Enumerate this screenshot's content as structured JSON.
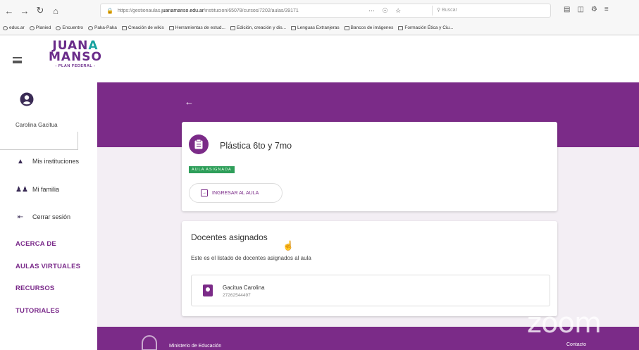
{
  "browser": {
    "url_prefix": "https://gestionaulas.",
    "url_domain": "juanamanso.edu.ar",
    "url_path": "/institucion/65078/cursos/7202/aulas/39171",
    "search_placeholder": "Buscar",
    "bookmarks": [
      "educ.ar",
      "Planied",
      "Encuentro",
      "Paka-Paka",
      "Creación de wikis",
      "Herramientas de estud...",
      "Edición, creación y dis...",
      "Lenguas Extranjeras",
      "Bancos de imágenes",
      "Formación Ética y Ciu..."
    ]
  },
  "logo": {
    "line1_a": "JUAN",
    "line1_b": "A",
    "line2": "MANSO",
    "line3": "- PLAN FEDERAL -"
  },
  "sidebar": {
    "user_name": "Carolina Gacitua",
    "items": [
      {
        "label": "Mis instituciones",
        "icon": "graduation-cap-icon"
      },
      {
        "label": "Mi familia",
        "icon": "family-icon"
      },
      {
        "label": "Cerrar sesión",
        "icon": "logout-icon"
      }
    ],
    "links": [
      "ACERCA DE",
      "AULAS VIRTUALES",
      "RECURSOS",
      "TUTORIALES"
    ]
  },
  "classroom": {
    "title": "Plástica 6to y 7mo",
    "badge": "AULA ASIGNADA",
    "enter_label": "INGRESAR AL AULA"
  },
  "teachers": {
    "title": "Docentes asignados",
    "description": "Este es el listado de docentes asignados al aula",
    "list": [
      {
        "name": "Gacitua Carolina",
        "id": "27262544497"
      }
    ]
  },
  "footer": {
    "ministry": "Ministerio de Educación",
    "contact": "Contacto"
  },
  "overlay": {
    "zoom": "zoom"
  },
  "colors": {
    "brand": "#7b2b88",
    "badge": "#2e9e5a"
  }
}
